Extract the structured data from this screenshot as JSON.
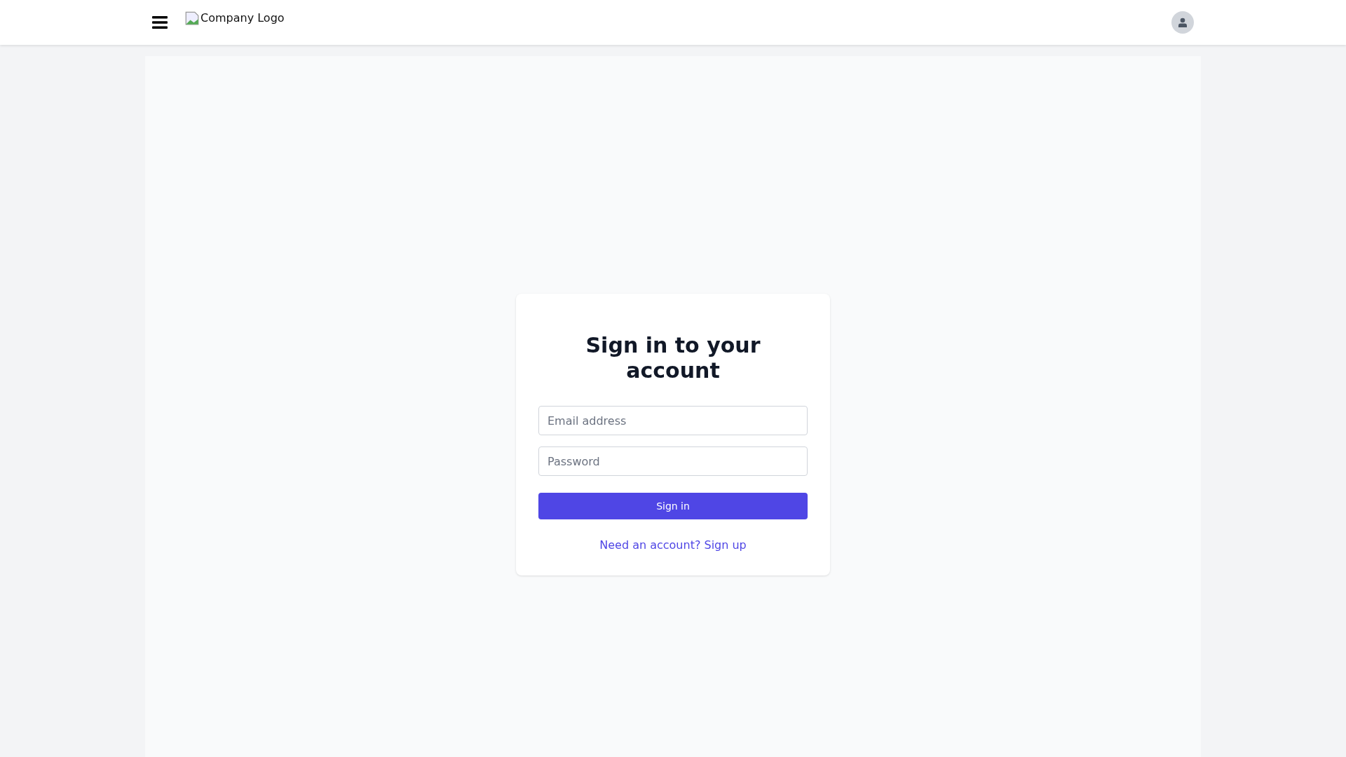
{
  "header": {
    "logo_alt": "Company Logo"
  },
  "signin": {
    "title": "Sign in to your account",
    "fields": [
      {
        "placeholder": "Email address"
      },
      {
        "placeholder": "Password"
      }
    ],
    "button": "Sign in",
    "link": "Need an account? Sign up"
  }
}
